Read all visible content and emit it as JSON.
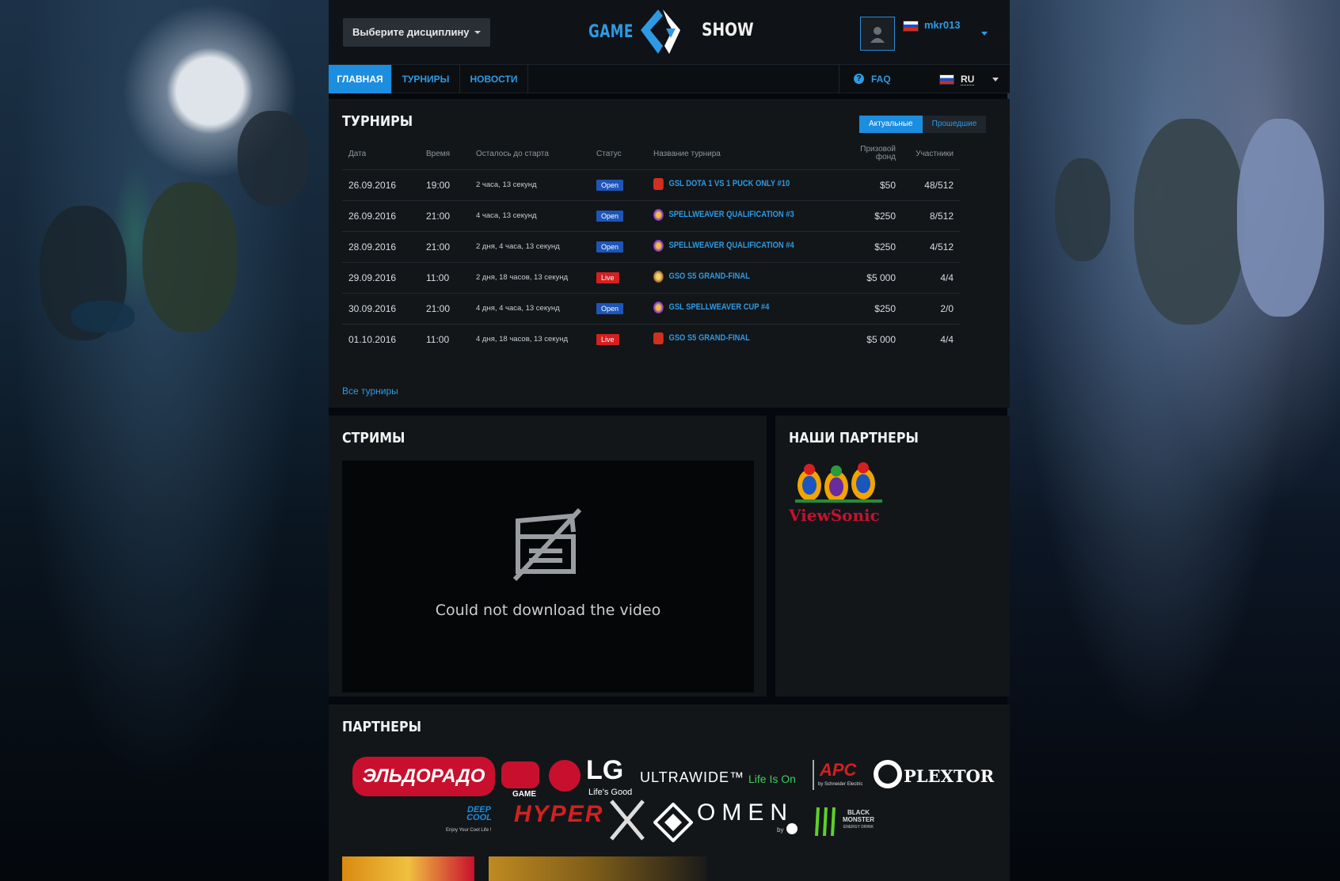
{
  "header": {
    "discipline_label": "Выберите дисциплину",
    "logo_left": "GAME",
    "logo_right": "SHOW",
    "username": "mkr013"
  },
  "nav": {
    "items": [
      {
        "label": "ГЛАВНАЯ"
      },
      {
        "label": "ТУРНИРЫ"
      },
      {
        "label": "НОВОСТИ"
      }
    ],
    "faq": "FAQ",
    "lang": "RU"
  },
  "tournaments": {
    "title": "ТУРНИРЫ",
    "tabs": [
      "Актуальные",
      "Прошедшие"
    ],
    "columns": [
      "Дата",
      "Время",
      "Осталось до старта",
      "Статус",
      "Название турнира",
      "Призовой фонд",
      "Участники"
    ],
    "rows": [
      {
        "date": "26.09.2016",
        "time": "19:00",
        "left": "2 часа, 13 секунд",
        "status": "Open",
        "game": "dota",
        "name": "GSL DOTA 1 VS 1 PUCK ONLY #10",
        "prize": "$50",
        "players": "48/512"
      },
      {
        "date": "26.09.2016",
        "time": "21:00",
        "left": "4 часа, 13 секунд",
        "status": "Open",
        "game": "spellweaver",
        "name": "SPELLWEAVER QUALIFICATION #3",
        "prize": "$250",
        "players": "8/512"
      },
      {
        "date": "28.09.2016",
        "time": "21:00",
        "left": "2 дня, 4 часа, 13 секунд",
        "status": "Open",
        "game": "spellweaver",
        "name": "SPELLWEAVER QUALIFICATION #4",
        "prize": "$250",
        "players": "4/512"
      },
      {
        "date": "29.09.2016",
        "time": "11:00",
        "left": "2 дня, 18 часов, 13 секунд",
        "status": "Live",
        "game": "gso",
        "name": "GSO S5 GRAND-FINAL",
        "prize": "$5 000",
        "players": "4/4"
      },
      {
        "date": "30.09.2016",
        "time": "21:00",
        "left": "4 дня, 4 часа, 13 секунд",
        "status": "Open",
        "game": "spellweaver",
        "name": "GSL SPELLWEAVER CUP #4",
        "prize": "$250",
        "players": "2/0"
      },
      {
        "date": "01.10.2016",
        "time": "11:00",
        "left": "4 дня, 18 часов, 13 секунд",
        "status": "Live",
        "game": "dota",
        "name": "GSO S5 GRAND-FINAL",
        "prize": "$5 000",
        "players": "4/4"
      }
    ],
    "all_link": "Все турниры"
  },
  "streams": {
    "title": "СТРИМЫ",
    "error": "Could not download the video"
  },
  "our_partners": {
    "title": "НАШИ ПАРТНЕРЫ",
    "logo": "ViewSonic"
  },
  "partners": {
    "title": "ПАРТНЕРЫ",
    "logos": [
      "ЭЛЬДОРАДО",
      "GAME",
      "LG",
      "Life's Good",
      "ULTRAWIDE™",
      "Life Is On",
      "APC",
      "by Schneider Electric",
      "PLEXTOR",
      "DEEP COOL",
      "Enjoy Your Cool Life !",
      "HYPER",
      "OMEN",
      "by",
      "BLACK MONSTER",
      "ENERGY DRINK"
    ]
  },
  "colors": {
    "accent": "#2e9ae4",
    "live": "#d42020",
    "open": "#1e55b8",
    "panel": "#121619"
  }
}
